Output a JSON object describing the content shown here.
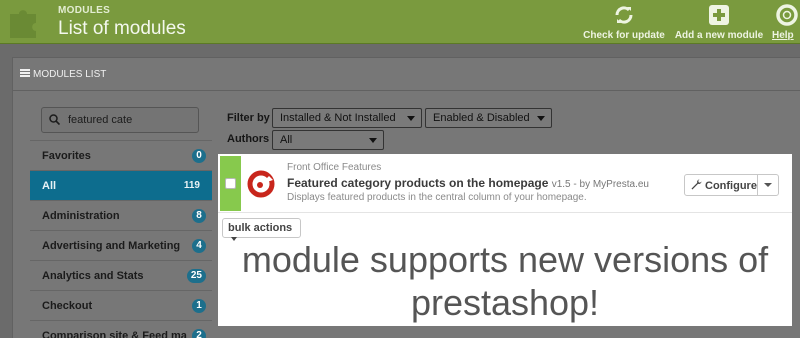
{
  "header": {
    "kicker": "MODULES",
    "title": "List of modules",
    "buttons": [
      {
        "label": "Check for update",
        "icon": "refresh-icon"
      },
      {
        "label": "Add a new module",
        "icon": "plus-square-icon"
      },
      {
        "label": "Help",
        "icon": "lifebuoy-icon"
      }
    ],
    "brand_color": "#7a9a3e"
  },
  "panel": {
    "title": "MODULES LIST"
  },
  "search": {
    "value": "featured cate",
    "placeholder": ""
  },
  "sidebar": {
    "items": [
      {
        "label": "Favorites",
        "count": "0"
      },
      {
        "label": "All",
        "count": "119",
        "active": true
      },
      {
        "label": "Administration",
        "count": "8"
      },
      {
        "label": "Advertising and Marketing",
        "count": "4"
      },
      {
        "label": "Analytics and Stats",
        "count": "25"
      },
      {
        "label": "Checkout",
        "count": "1"
      },
      {
        "label": "Comparison site & Feed ma",
        "count": "2"
      }
    ],
    "active_color": "#0d6d8e"
  },
  "filters": {
    "filter_label": "Filter by",
    "install_value": "Installed & Not Installed",
    "enabled_value": "Enabled & Disabled",
    "authors_label": "Authors",
    "authors_value": "All"
  },
  "module": {
    "category": "Front Office Features",
    "name": "Featured category products on the homepage",
    "version": "v1.5 - by MyPresta.eu",
    "description": "Displays featured products in the central column of your homepage.",
    "configure_label": "Configure",
    "status_color": "#87c94d"
  },
  "bulk": {
    "label": "bulk actions"
  },
  "message": {
    "line1": "module supports new versions of",
    "line2": "prestashop!"
  }
}
